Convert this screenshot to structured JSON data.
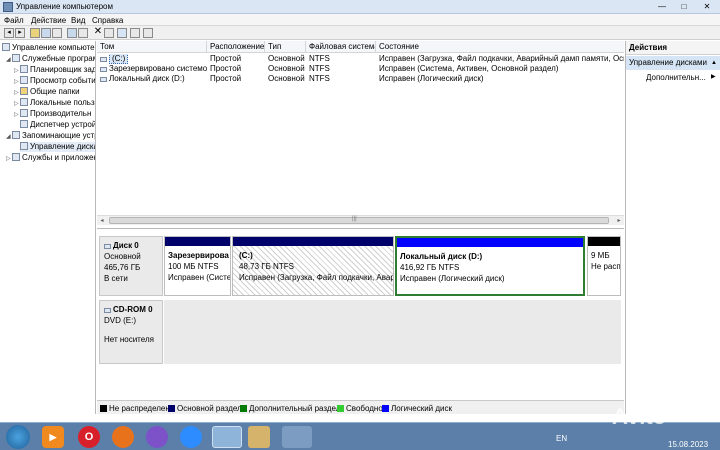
{
  "window": {
    "title": "Управление компьютером",
    "minimize": "—",
    "maximize": "□",
    "close": "✕"
  },
  "menu": [
    "Файл",
    "Действие",
    "Вид",
    "Справка"
  ],
  "toolbar": {
    "icons": [
      "back-icon",
      "forward-icon",
      "up-icon",
      "show-tree-icon",
      "properties-icon",
      "help-icon",
      "export-icon",
      "delete-icon",
      "settings-icon",
      "refresh-icon",
      "new-icon",
      "list-icon"
    ]
  },
  "tree": [
    {
      "label": "Управление компьютер",
      "expander": "",
      "icon": "computer-icon"
    },
    {
      "label": "Служебные програм",
      "expander": "◢",
      "icon": "tools-icon"
    },
    {
      "label": "Планировщик зад",
      "expander": "▷",
      "icon": "scheduler-icon"
    },
    {
      "label": "Просмотр событи",
      "expander": "▷",
      "icon": "event-viewer-icon"
    },
    {
      "label": "Общие папки",
      "expander": "▷",
      "icon": "folder-icon"
    },
    {
      "label": "Локальные польз",
      "expander": "▷",
      "icon": "users-icon"
    },
    {
      "label": "Производительн",
      "expander": "▷",
      "icon": "performance-icon"
    },
    {
      "label": "Диспетчер устрой",
      "expander": "",
      "icon": "device-manager-icon"
    },
    {
      "label": "Запоминающие устр",
      "expander": "◢",
      "icon": "storage-icon"
    },
    {
      "label": "Управление диска",
      "expander": "",
      "icon": "disk-management-icon"
    },
    {
      "label": "Службы и приложен",
      "expander": "▷",
      "icon": "services-icon"
    }
  ],
  "volumes": {
    "columns": [
      "Том",
      "Расположение",
      "Тип",
      "Файловая система",
      "Состояние"
    ],
    "rows": [
      {
        "name": "(C:)",
        "location": "Простой",
        "type": "Основной",
        "fs": "NTFS",
        "status": "Исправен (Загрузка, Файл подкачки, Аварийный дамп памяти, Основ"
      },
      {
        "name": "Зарезервировано системой",
        "location": "Простой",
        "type": "Основной",
        "fs": "NTFS",
        "status": "Исправен (Система, Активен, Основной раздел)"
      },
      {
        "name": "Локальный диск (D:)",
        "location": "Простой",
        "type": "Основной",
        "fs": "NTFS",
        "status": "Исправен (Логический диск)"
      }
    ],
    "scroll_left": "◂",
    "scroll_right": "▸",
    "scroll_grip": "|||"
  },
  "disk0": {
    "name": "Диск 0",
    "type": "Основной",
    "size": "465,76 ГБ",
    "status": "В сети",
    "partitions": [
      {
        "title": "Зарезервирова",
        "size": "100 МБ NTFS",
        "status": "Исправен (Систем",
        "color": "#00006a"
      },
      {
        "title": "(C:)",
        "size": "48,73 ГБ NTFS",
        "status": "Исправен (Загрузка, Файл подкачки, Аварий",
        "color": "#00006a"
      },
      {
        "title": "Локальный диск  (D:)",
        "size": "416,92 ГБ NTFS",
        "status": "Исправен (Логический диск)",
        "color": "#0000ff"
      },
      {
        "title": "",
        "size": "9 МБ",
        "status": "Не расп",
        "color": "#000000"
      }
    ]
  },
  "cdrom0": {
    "name": "CD-ROM 0",
    "drive": "DVD (E:)",
    "status": "Нет носителя"
  },
  "legend": [
    {
      "label": "Не распределен",
      "color": "#000000"
    },
    {
      "label": "Основной раздел",
      "color": "#00006a"
    },
    {
      "label": "Дополнительный раздел",
      "color": "#007a00"
    },
    {
      "label": "Свободно",
      "color": "#33cc33"
    },
    {
      "label": "Логический диск",
      "color": "#0000ff"
    }
  ],
  "actions": {
    "title": "Действия",
    "section": "Управление дисками",
    "more": "Дополнительн...",
    "arrow": "▲",
    "more_arrow": "▶"
  },
  "taskbar": {
    "apps": [
      "start-orb-icon",
      "media-player-icon",
      "opera-icon",
      "firefox-icon",
      "viber-icon",
      "zoom-icon",
      "computer-management-icon",
      "paint-icon",
      "network-icon"
    ],
    "lang": "EN",
    "date": "15.08.2023"
  },
  "watermark": "Avito"
}
